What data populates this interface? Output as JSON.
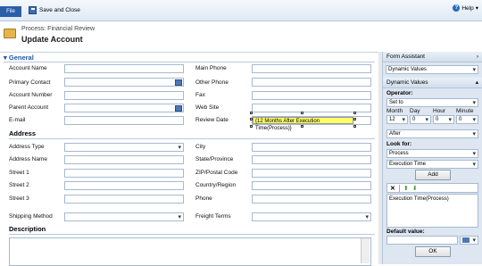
{
  "ribbon": {
    "file_label": "File",
    "save_close_label": "Save and Close",
    "help_label": "Help",
    "help_caret": "▾"
  },
  "header": {
    "process_label": "Process: Financial Review",
    "title": "Update Account"
  },
  "general": {
    "section_title": "General",
    "left": [
      "Account Name",
      "Primary Contact",
      "Account Number",
      "Parent Account",
      "E-mail"
    ],
    "right": [
      "Main Phone",
      "Other Phone",
      "Fax",
      "Web Site",
      "Review Date"
    ],
    "review_date_value": "{12 Months After Execution Time(Process)}"
  },
  "address": {
    "section_title": "Address",
    "left": [
      "Address Type",
      "Address Name",
      "Street 1",
      "Street 2",
      "Street 3"
    ],
    "right": [
      "City",
      "State/Province",
      "ZIP/Postal Code",
      "Country/Region",
      "Phone"
    ],
    "shipping_label": "Shipping Method",
    "freight_label": "Freight Terms"
  },
  "description": {
    "section_title": "Description"
  },
  "panel": {
    "form_assistant": "Form Assistant",
    "form_assistant_arrow": "›",
    "dynamic_values_select": "Dynamic Values",
    "dynamic_values_header": "Dynamic Values",
    "dynamic_values_toggle": "▴",
    "operator_label": "Operator:",
    "operator_value": "Set to",
    "month_label": "Month",
    "day_label": "Day",
    "hour_label": "Hour",
    "minute_label": "Minute",
    "month_value": "12",
    "day_value": "0",
    "hour_value": "0",
    "minute_value": "0",
    "after_value": "After",
    "look_for_label": "Look for:",
    "look_for_entity": "Process",
    "look_for_field": "Execution Time",
    "add_button": "Add",
    "selected_value": "Execution Time(Process)",
    "default_value_label": "Default value:",
    "ok_button": "OK"
  }
}
